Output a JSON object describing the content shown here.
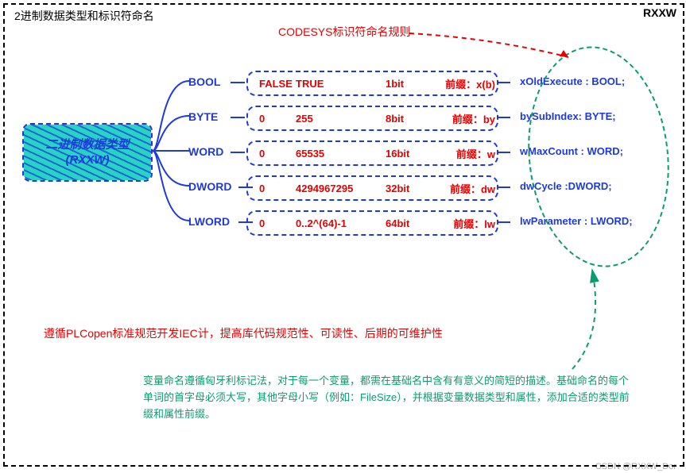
{
  "frame": {
    "title": "2进制数据类型和标识符命名",
    "brand": "RXXW"
  },
  "ruleTitle": "CODESYS标识符命名规则",
  "root": {
    "label": "二进制数据类型(RXXW)"
  },
  "types": [
    {
      "name": "BOOL",
      "min": "FALSE",
      "max": "TRUE",
      "size": "1bit",
      "prefixLabel": "前缀：x(b)",
      "example": "xOldExecute : BOOL;"
    },
    {
      "name": "BYTE",
      "min": "0",
      "max": "255",
      "size": "8bit",
      "prefixLabel": "前缀：by",
      "example": "bySubIndex: BYTE;"
    },
    {
      "name": "WORD",
      "min": "0",
      "max": "65535",
      "size": "16bit",
      "prefixLabel": "前缀：w",
      "example": "wMaxCount : WORD;"
    },
    {
      "name": "DWORD",
      "min": "0",
      "max": "4294967295",
      "size": "32bit",
      "prefixLabel": "前缀：dw",
      "example": "dwCycle :DWORD;"
    },
    {
      "name": "LWORD",
      "min": "0",
      "max": "0..2^(64)-1",
      "size": "64bit",
      "prefixLabel": "前缀：lw",
      "example": "lwParameter : LWORD;"
    }
  ],
  "footerRed": "遵循PLCopen标准规范开发IEC计，提高库代码规范性、可读性、后期的可维护性",
  "footerGreen": "变量命名遵循匈牙利标记法，对于每一个变量，都需在基础名中含有有意义的简短的描述。基础命名的每个单词的首字母必须大写，其他字母小写（例如：FileSize），并根据变量数据类型和属性，添加合适的类型前缀和属性前缀。",
  "watermark": "CSDN @RXXW_Dor",
  "colors": {
    "blue": "#1e39e0",
    "red": "#e60000",
    "green": "#0a9c6e",
    "teal": "#27d3c2"
  }
}
